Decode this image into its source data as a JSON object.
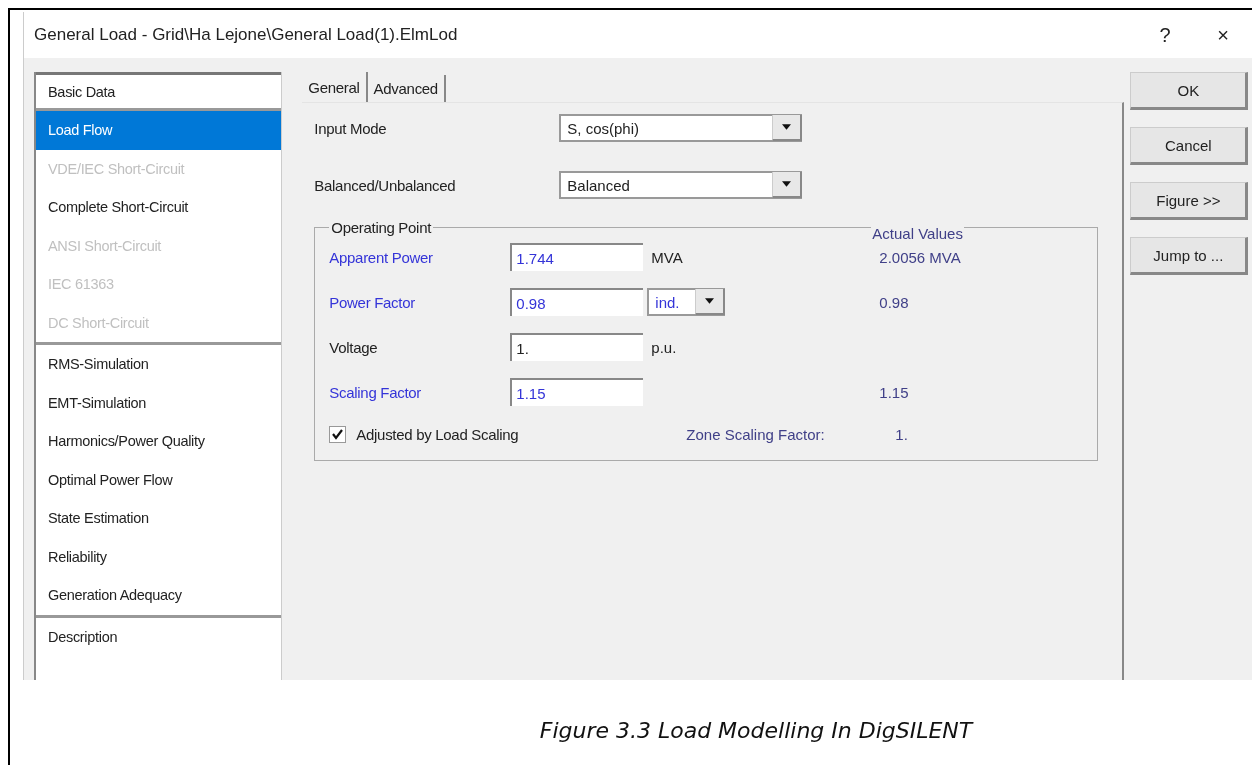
{
  "dialog": {
    "title": "General Load - Grid\\Ha Lejone\\General Load(1).ElmLod",
    "help": "?",
    "close": "×"
  },
  "sidebar": {
    "groups": [
      [
        {
          "label": "Basic Data",
          "selected": false,
          "disabled": false
        }
      ],
      [
        {
          "label": "Load Flow",
          "selected": true,
          "disabled": false
        },
        {
          "label": "VDE/IEC Short-Circuit",
          "selected": false,
          "disabled": true
        },
        {
          "label": "Complete Short-Circuit",
          "selected": false,
          "disabled": false
        },
        {
          "label": "ANSI Short-Circuit",
          "selected": false,
          "disabled": true
        },
        {
          "label": "IEC 61363",
          "selected": false,
          "disabled": true
        },
        {
          "label": "DC Short-Circuit",
          "selected": false,
          "disabled": true
        }
      ],
      [
        {
          "label": "RMS-Simulation",
          "selected": false,
          "disabled": false
        },
        {
          "label": "EMT-Simulation",
          "selected": false,
          "disabled": false
        },
        {
          "label": "Harmonics/Power Quality",
          "selected": false,
          "disabled": false
        },
        {
          "label": "Optimal Power Flow",
          "selected": false,
          "disabled": false
        },
        {
          "label": "State Estimation",
          "selected": false,
          "disabled": false
        },
        {
          "label": "Reliability",
          "selected": false,
          "disabled": false
        },
        {
          "label": "Generation Adequacy",
          "selected": false,
          "disabled": false
        }
      ],
      [
        {
          "label": "Description",
          "selected": false,
          "disabled": false
        }
      ]
    ]
  },
  "tabs": [
    {
      "label": "General",
      "selected": true
    },
    {
      "label": "Advanced",
      "selected": false
    }
  ],
  "selects": [
    {
      "label": "Input Mode",
      "value": "S, cos(phi)"
    },
    {
      "label": "Balanced/Unbalanced",
      "value": "Balanced"
    }
  ],
  "operating_point": {
    "title": "Operating Point",
    "actual_title": "Actual Values",
    "rows": [
      {
        "label": "Apparent Power",
        "highlighted": true,
        "value": "1.744",
        "kind": "text",
        "unit": "MVA",
        "actual": "2.0056 MVA"
      },
      {
        "label": "Power Factor",
        "highlighted": true,
        "value": "0.98",
        "kind": "select",
        "unit": "ind.",
        "actual": "0.98"
      },
      {
        "label": "Voltage",
        "highlighted": false,
        "value": "1.",
        "kind": "text",
        "unit": "p.u."
      },
      {
        "label": "Scaling Factor",
        "highlighted": true,
        "value": "1.15",
        "actual": "1.15"
      }
    ],
    "checkbox": {
      "label": "Adjusted by Load Scaling",
      "checked": true
    },
    "zone_label": "Zone Scaling Factor:",
    "zone_value": "1."
  },
  "buttons": [
    "OK",
    "Cancel",
    "Figure >>",
    "Jump to ..."
  ],
  "caption": "Figure 3.3 Load Modelling In DigSILENT"
}
